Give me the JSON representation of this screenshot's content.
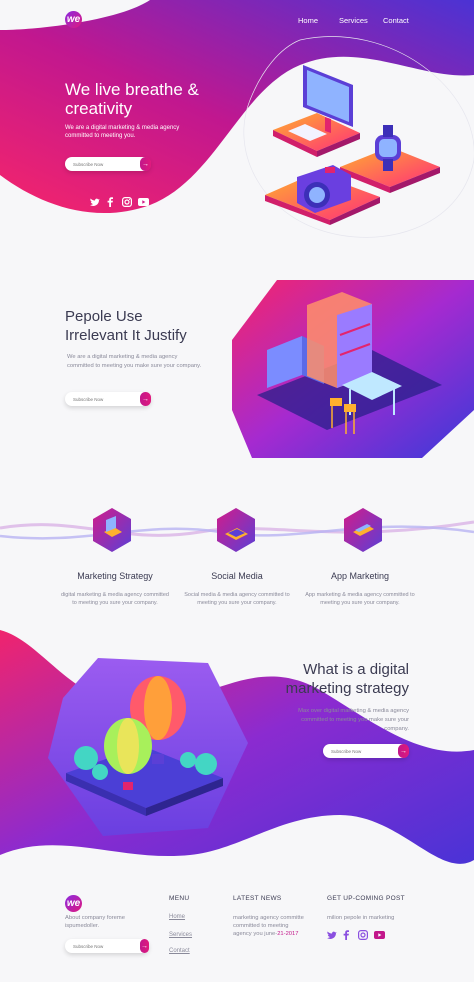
{
  "header": {
    "logo": "we",
    "nav": [
      "Home",
      "Services",
      "Contact"
    ]
  },
  "hero": {
    "title": "We live breathe & creativity",
    "subtitle": "We are a digital marketing & media agency committed to meeting you.",
    "input_placeholder": "Subscribe Now",
    "social": [
      "twitter-icon",
      "facebook-icon",
      "instagram-icon",
      "youtube-icon"
    ]
  },
  "section2": {
    "title_line1": "Pepole Use",
    "title_line2": "Irrelevant It Justify",
    "text": "We are a digital marketing & media agency committed to meeting you make sure your company.",
    "input_placeholder": "Subscribe Now"
  },
  "features": [
    {
      "title": "Marketing Strategy",
      "text": "digital marketing & media agency committed to meeting you sure your company."
    },
    {
      "title": "Social Media",
      "text": "Social media & media agency committed to meeting you sure your company."
    },
    {
      "title": "App Marketing",
      "text": "App marketing & media agency committed to meeting you sure your company."
    }
  ],
  "section4": {
    "title_line1": "What is a digital",
    "title_line2": "marketing strategy",
    "text": "Max over digital marketing & media agency committed to meeting you make sure your company.",
    "input_placeholder": "Subscribe Now"
  },
  "footer": {
    "logo": "we",
    "about": "About company foreme ispumedoller.",
    "input_placeholder": "Subscribe Now",
    "menu_title": "MENU",
    "menu": [
      "Home",
      "Services",
      "Contact"
    ],
    "news_title": "LATEST NEWS",
    "news_text": "marketing agency committe committed to meeting agency",
    "news_prefix": "you june-",
    "news_date": "21-2017",
    "post_title": "GET UP-COMING POST",
    "post_text": "milion pepole in marketing"
  },
  "colors": {
    "purple": "#5b3fd6",
    "pink": "#e0197d",
    "magenta": "#c2188b",
    "text": "#3b3b52"
  }
}
